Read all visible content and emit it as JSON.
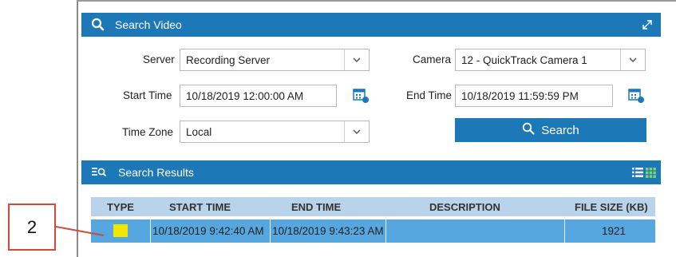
{
  "search_panel": {
    "title": "Search Video",
    "fields": {
      "server": {
        "label": "Server",
        "value": "Recording Server"
      },
      "camera": {
        "label": "Camera",
        "value": "12 - QuickTrack Camera 1"
      },
      "start_time": {
        "label": "Start Time",
        "value": "10/18/2019 12:00:00 AM"
      },
      "end_time": {
        "label": "End Time",
        "value": "10/18/2019 11:59:59 PM"
      },
      "time_zone": {
        "label": "Time Zone",
        "value": "Local"
      }
    },
    "search_button": "Search"
  },
  "results_panel": {
    "title": "Search Results",
    "columns": [
      "TYPE",
      "START TIME",
      "END TIME",
      "DESCRIPTION",
      "FILE SIZE (KB)"
    ],
    "rows": [
      {
        "type_color": "#f2e600",
        "start_time": "10/18/2019 9:42:40 AM",
        "end_time": "10/18/2019 9:43:23 AM",
        "description": "",
        "file_size": "1921"
      }
    ]
  },
  "callout": {
    "label": "2"
  },
  "colors": {
    "accent": "#1d78b8",
    "selected_row": "#56a6df",
    "header_row": "#b9d3ea",
    "callout": "#d24a37"
  }
}
